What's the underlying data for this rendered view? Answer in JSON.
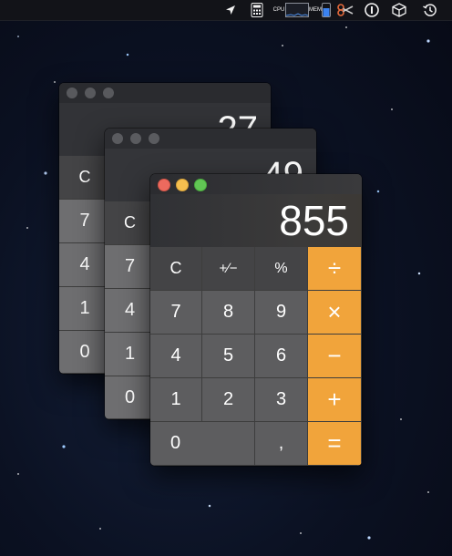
{
  "menubar": {
    "cpu_label": "CPU",
    "mem_label": "MEM"
  },
  "calc_back": {
    "display": "27",
    "keys": [
      "C",
      "7",
      "4",
      "1",
      "0"
    ]
  },
  "calc_mid": {
    "display": "49",
    "keys": [
      "C",
      "7",
      "4",
      "1",
      "0"
    ]
  },
  "calc_front": {
    "display": "855",
    "keys": {
      "clear": "C",
      "sign": "+∕−",
      "percent": "%",
      "divide": "÷",
      "seven": "7",
      "eight": "8",
      "nine": "9",
      "multiply": "×",
      "four": "4",
      "five": "5",
      "six": "6",
      "minus": "−",
      "one": "1",
      "two": "2",
      "three": "3",
      "plus": "+",
      "zero": "0",
      "decimal": ",",
      "equals": "="
    }
  },
  "colors": {
    "operator": "#f1a43b",
    "close": "#ed6a5e",
    "minimize": "#f5bf4f",
    "zoom": "#61c554"
  }
}
